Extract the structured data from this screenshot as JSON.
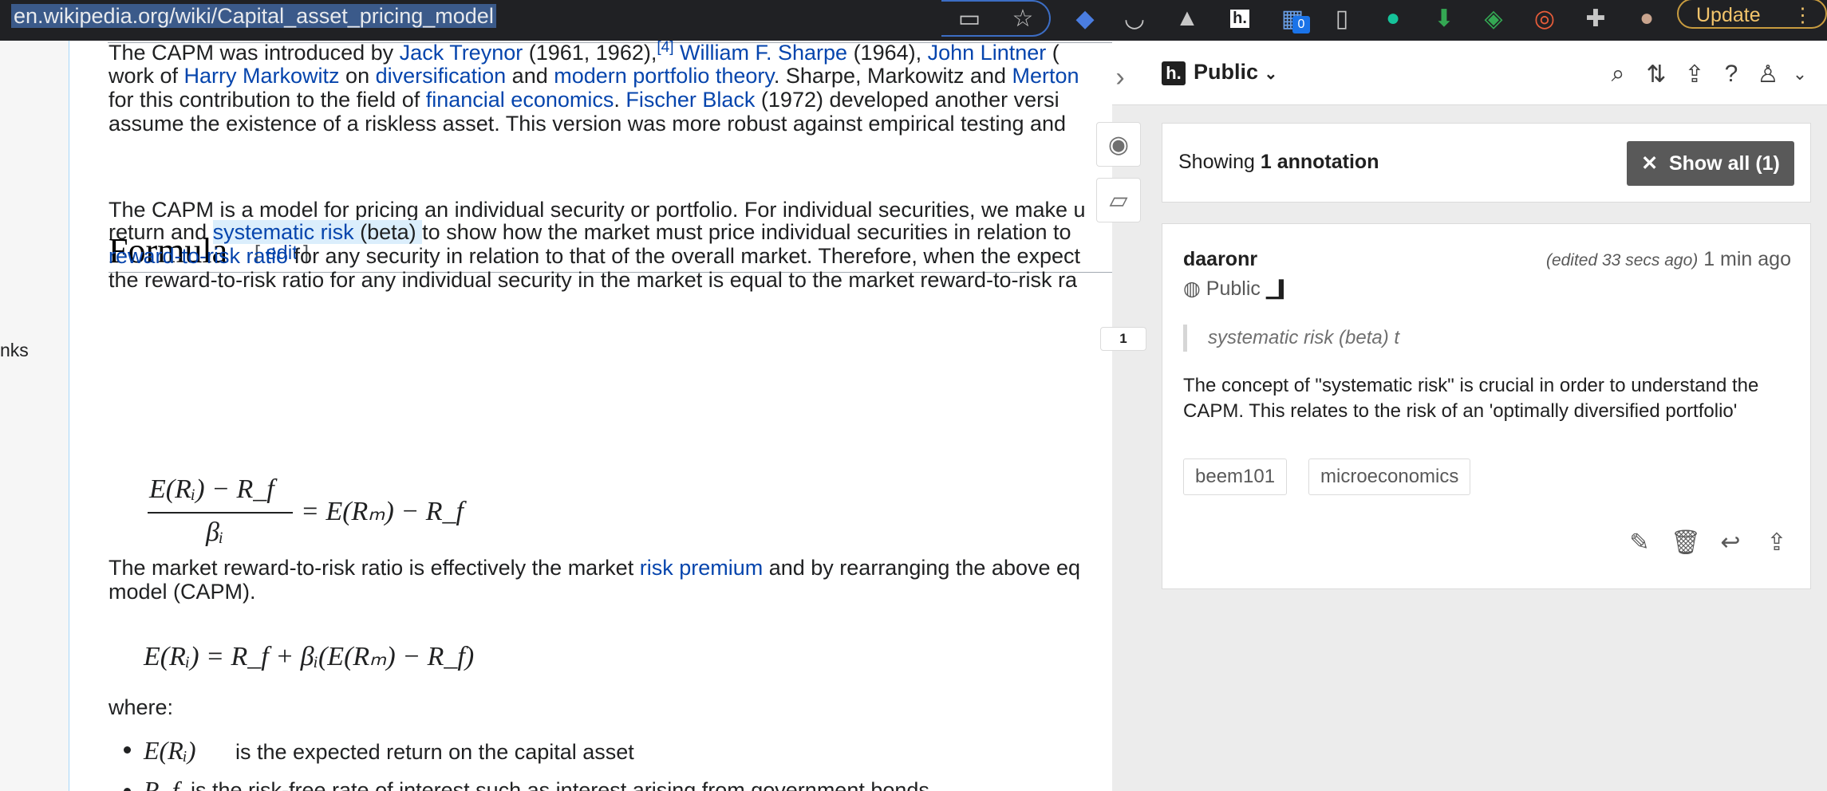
{
  "browser": {
    "url": "en.wikipedia.org/wiki/Capital_asset_pricing_model",
    "update_label": "Update",
    "badge_count": "0"
  },
  "left_gutter_text": "nks",
  "article": {
    "lines": [
      [
        {
          "t": "The CAPM was introduced by "
        },
        {
          "t": "Jack Treynor",
          "link": true
        },
        {
          "t": " (1961, 1962),"
        },
        {
          "t": "[4]",
          "sup": true
        },
        {
          "t": " "
        },
        {
          "t": "William F. Sharpe",
          "link": true
        },
        {
          "t": " (1964), "
        },
        {
          "t": "John Lintner",
          "link": true
        },
        {
          "t": " ("
        }
      ],
      [
        {
          "t": "work of "
        },
        {
          "t": "Harry Markowitz",
          "link": true
        },
        {
          "t": " on "
        },
        {
          "t": "diversification",
          "link": true
        },
        {
          "t": " and "
        },
        {
          "t": "modern portfolio theory",
          "link": true
        },
        {
          "t": ". Sharpe, Markowitz and "
        },
        {
          "t": "Merton",
          "link": true
        }
      ],
      [
        {
          "t": "for this contribution to the field of "
        },
        {
          "t": "financial economics",
          "link": true
        },
        {
          "t": ". "
        },
        {
          "t": "Fischer Black",
          "link": true
        },
        {
          "t": " (1972) developed another versi"
        }
      ],
      [
        {
          "t": "assume the existence of a riskless asset. This version was more robust against empirical testing and"
        }
      ]
    ],
    "heading": "Formula",
    "edit_open": "[ ",
    "edit_label": "edit",
    "edit_close": " ]",
    "formula_lines": [
      [
        {
          "t": "The CAPM is a model for pricing an individual security or portfolio. For individual securities, we make u"
        }
      ],
      [
        {
          "t": "return and "
        },
        {
          "t": "systematic risk",
          "link": true,
          "hl": true
        },
        {
          "t": " (beta) ",
          "hl": true
        },
        {
          "t": "to show how the market must price individual securities in relation to"
        }
      ],
      [
        {
          "t": "reward-to-risk ratio",
          "link": true
        },
        {
          "t": " for any security in relation to that of the overall market. Therefore, when the expect"
        }
      ],
      [
        {
          "t": "the reward-to-risk ratio for any individual security in the market is equal to the market reward-to-risk ra"
        }
      ]
    ],
    "eq1_num": "E(Rᵢ) − R_f",
    "eq1_den": "βᵢ",
    "eq1_rhs": "= E(Rₘ) − R_f",
    "para2_lines": [
      [
        {
          "t": "The market reward-to-risk ratio is effectively the market "
        },
        {
          "t": "risk premium",
          "link": true
        },
        {
          "t": " and by rearranging the above eq"
        }
      ],
      [
        {
          "t": "model (CAPM)."
        }
      ]
    ],
    "eq2": "E(Rᵢ) = R_f + βᵢ(E(Rₘ) − R_f)",
    "where": "where:",
    "bullets": [
      {
        "sym": "E(Rᵢ)",
        "text": "is the expected return on the capital asset"
      },
      {
        "sym": "R_f",
        "text": "is the risk-free rate of interest such as interest arising from government bonds"
      }
    ]
  },
  "hypothesis": {
    "logo": "h.",
    "group": "Public",
    "bucket_count": "1",
    "showing_prefix": "Showing ",
    "showing_count": "1 annotation",
    "show_all": "Show all (1)",
    "annotation": {
      "user": "daaronr",
      "edited": "(edited 33 secs ago)",
      "time": " 1 min ago",
      "visibility": "Public",
      "quote": "systematic risk (beta) t",
      "body": "The concept of \"systematic risk\" is crucial in order to understand the CAPM. This relates to the risk of an 'optimally diversified portfolio'",
      "tags": [
        "beem101",
        "microeconomics"
      ]
    }
  },
  "colors": {
    "link": "#0645ad",
    "highlight": "#dbeefc",
    "accent_dark": "#595959"
  }
}
